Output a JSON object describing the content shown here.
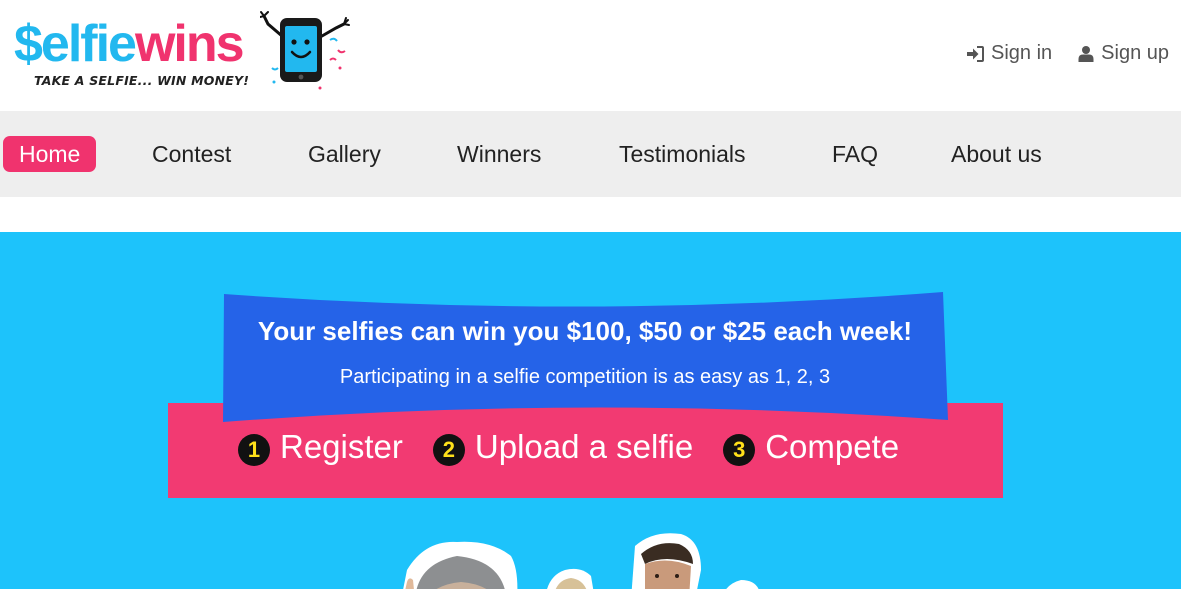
{
  "brand": {
    "logo_part1": "$elfie",
    "logo_part2": "wins",
    "tagline": "TAKE A SELFIE... WIN MONEY!",
    "colors": {
      "blue": "#22b8ef",
      "pink": "#f0336e"
    }
  },
  "auth": {
    "sign_in": {
      "label": "Sign in",
      "icon": "sign-in-icon"
    },
    "sign_up": {
      "label": "Sign up",
      "icon": "user-icon"
    }
  },
  "nav": {
    "items": [
      {
        "label": "Home",
        "active": true
      },
      {
        "label": "Contest"
      },
      {
        "label": "Gallery"
      },
      {
        "label": "Winners"
      },
      {
        "label": "Testimonials"
      },
      {
        "label": "FAQ"
      },
      {
        "label": "About us"
      }
    ]
  },
  "hero": {
    "headline": "Your selfies can win you $100, $50 or $25 each week!",
    "subline": "Participating in a selfie competition is as easy as 1, 2, 3",
    "steps": [
      {
        "num": "1",
        "label": "Register"
      },
      {
        "num": "2",
        "label": "Upload a selfie"
      },
      {
        "num": "3",
        "label": "Compete"
      }
    ],
    "colors": {
      "background": "#1dc3fb",
      "ribbon": "#2563e8",
      "band": "#f23a72",
      "number_text": "#ffe11a"
    }
  }
}
